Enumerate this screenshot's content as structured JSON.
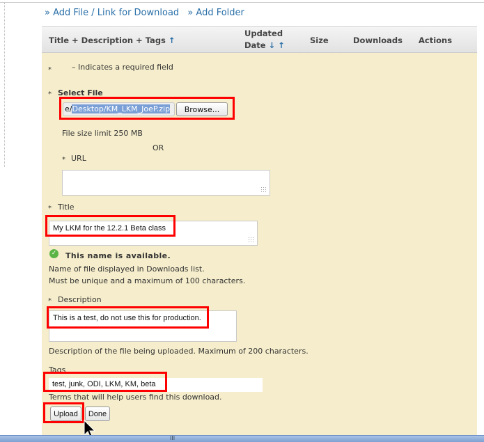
{
  "links": {
    "add_file": "» Add File / Link for Download",
    "add_folder": "» Add Folder"
  },
  "table_header": {
    "title": "Title + Description + Tags",
    "title_sort": "↑",
    "updated_1": "Updated",
    "updated_2": "Date",
    "updated_sort": "↓ ↑",
    "size": "Size",
    "downloads": "Downloads",
    "actions": "Actions"
  },
  "form": {
    "required_star": "*",
    "required_note": "– Indicates a required field",
    "select_file_label": "Select File",
    "file_prefix": "e/",
    "file_value": "Desktop/KM_LKM_JoeP.zip",
    "browse": "Browse...",
    "size_limit": "File size limit 250 MB",
    "or": "OR",
    "url_label": "URL",
    "url_value": "",
    "title_label": "Title",
    "title_value": "My LKM for the 12.2.1 Beta class",
    "available": "This name is available.",
    "title_help_1": "Name of file displayed in Downloads list.",
    "title_help_2": "Must be unique and a maximum of 100 characters.",
    "description_label": "Description",
    "description_value": "This is a test, do not use this for production.",
    "description_help": "Description of the file being uploaded. Maximum of 200 characters.",
    "tags_label": "Tags",
    "tags_value": "test, junk, ODI, LKM, KM, beta",
    "tags_help": "Terms that will help users find this download.",
    "upload": "Upload",
    "done": "Done"
  },
  "status_bar": {
    "grip": "III"
  },
  "colors": {
    "panel": "#f5edcb",
    "link": "#2a6fa8",
    "highlight": "#ff0000"
  }
}
